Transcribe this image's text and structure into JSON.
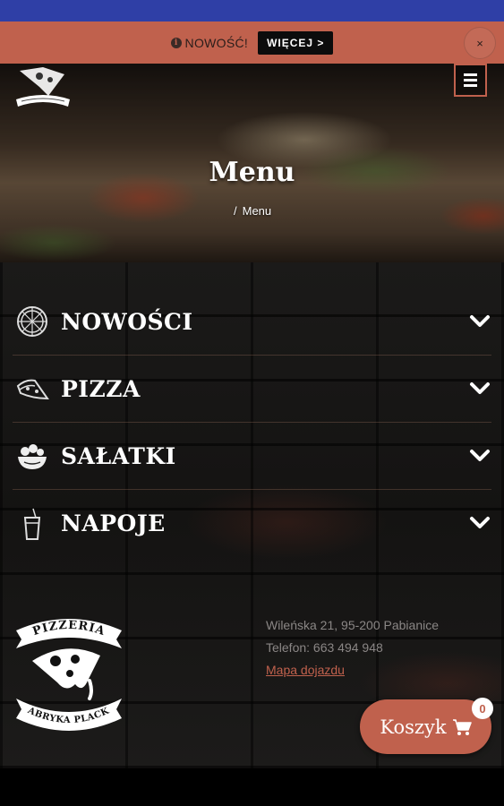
{
  "notice": {
    "info_icon": "info-circle-icon",
    "text": "NOWOŚĆ!",
    "more_label": "WIĘCEJ >",
    "close_label": "×"
  },
  "hero": {
    "title": "Menu",
    "breadcrumb_separator": "/",
    "breadcrumb_current": "Menu",
    "logo_text_top": "FABRYKA PLACKA"
  },
  "categories": [
    {
      "label": "NOWOŚCI",
      "icon": "pizza-whole-icon"
    },
    {
      "label": "PIZZA",
      "icon": "pizza-slice-icon"
    },
    {
      "label": "SAŁATKI",
      "icon": "salad-bowl-icon"
    },
    {
      "label": "NAPOJE",
      "icon": "drink-cup-icon"
    }
  ],
  "footer": {
    "logo_top": "PIZZERIA",
    "logo_bottom": "FABRYKA PLACKA",
    "address": "Wileńska 21, 95-200 Pabianice",
    "phone": "Telefon: 663 494 948",
    "map_link": "Mapa dojazdu"
  },
  "cart": {
    "label": "Koszyk",
    "count": "0",
    "icon": "cart-icon"
  },
  "colors": {
    "accent": "#c0614d",
    "status_bar": "#2f3fa6"
  }
}
